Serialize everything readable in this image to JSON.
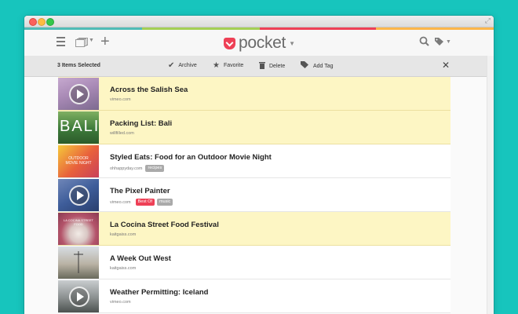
{
  "app": {
    "logo_text": "pocket"
  },
  "colors": {
    "background": "#17c5bd",
    "brand": "#ee4056",
    "selected_row": "#fdf6c4",
    "top_stripe": [
      "#50bcb6",
      "#a4cf54",
      "#ee4056",
      "#fcb64a"
    ]
  },
  "toolbar": {
    "icons": [
      "menu-icon",
      "list-view-icon",
      "add-icon",
      "search-icon",
      "tag-icon"
    ]
  },
  "actionbar": {
    "selected_label": "3 Items Selected",
    "archive_label": "Archive",
    "favorite_label": "Favorite",
    "delete_label": "Delete",
    "add_tag_label": "Add Tag"
  },
  "items": [
    {
      "title": "Across the Salish Sea",
      "domain": "vimeo.com",
      "selected": true
    },
    {
      "title": "Packing List: Bali",
      "domain": "willfilled.com",
      "selected": true,
      "thumb_text": "BALI"
    },
    {
      "title": "Styled Eats: Food for an Outdoor Movie Night",
      "domain": "ohhappyday.com",
      "selected": false,
      "tags": [
        "recipes"
      ],
      "thumb_text": "OUTDOOR MOVIE NIGHT"
    },
    {
      "title": "The Pixel Painter",
      "domain": "vimeo.com",
      "selected": false,
      "tags": [
        "Best Of",
        "music"
      ]
    },
    {
      "title": "La Cocina Street Food Festival",
      "domain": "kaitgaiss.com",
      "selected": true,
      "thumb_text": "LA COCINA STREET FOOD"
    },
    {
      "title": "A Week Out West",
      "domain": "kaitgaiss.com",
      "selected": false
    },
    {
      "title": "Weather Permitting: Iceland",
      "domain": "vimeo.com",
      "selected": false
    }
  ]
}
